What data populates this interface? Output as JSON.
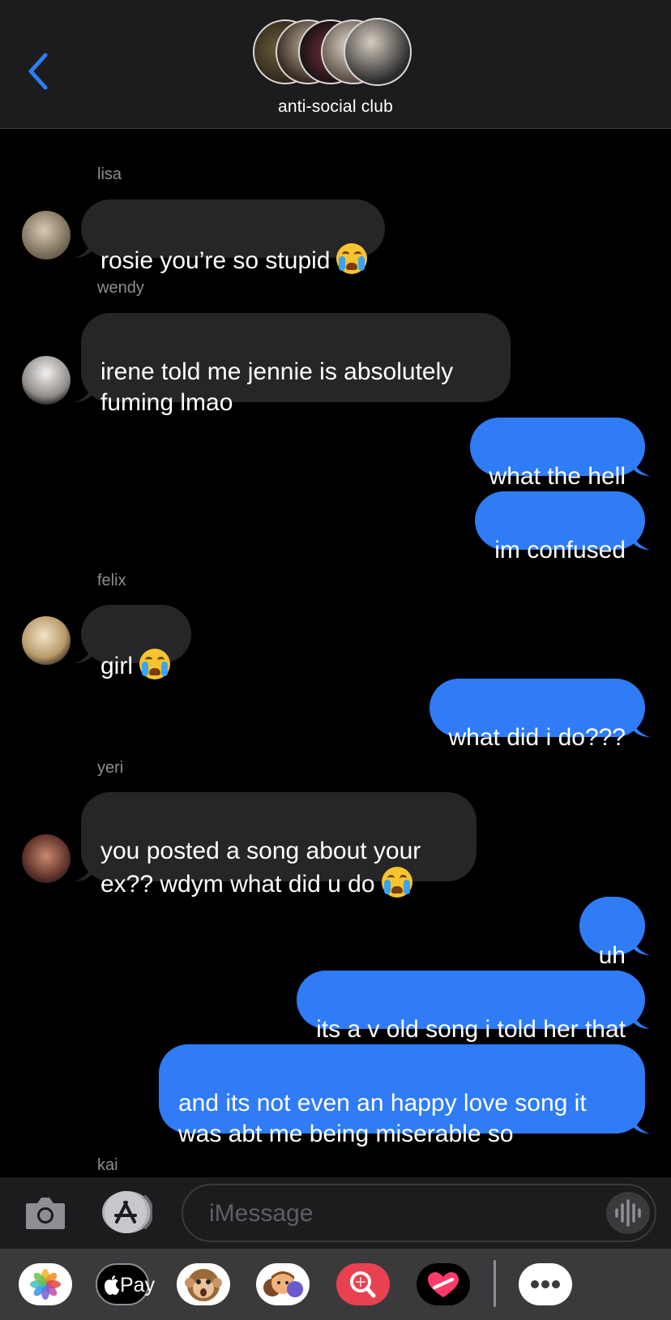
{
  "header": {
    "back_icon": "chevron-left-icon",
    "group_title": "anti-social club",
    "accent": "#2f7cf6"
  },
  "messages": [
    {
      "sender": "lisa",
      "text": "rosie you’re so stupid",
      "emoji": "loudly-crying-face"
    },
    {
      "sender": "wendy",
      "text": "irene told me jennie is absolutely\nfuming lmao"
    },
    {
      "sent": true,
      "text": "what the hell"
    },
    {
      "sent": true,
      "text": "im confused"
    },
    {
      "sender": "felix",
      "text": "girl",
      "emoji": "loudly-crying-face"
    },
    {
      "sent": true,
      "text": "what did i do???"
    },
    {
      "sender": "yeri",
      "text": "you posted a song about your\nex?? wdym what did u do",
      "emoji": "loudly-crying-face"
    },
    {
      "sent": true,
      "text": "uh"
    },
    {
      "sent": true,
      "text": "its a v old song i told her that"
    },
    {
      "sent": true,
      "text": "and its not even an happy love song it\nwas abt me being miserable so"
    },
    {
      "sender": "kai"
    }
  ],
  "input": {
    "placeholder": "iMessage",
    "camera_icon": "camera-icon",
    "appstore_icon": "app-store-icon",
    "audio_icon": "audio-waveform-icon"
  },
  "drawer": {
    "apps": [
      "photos-icon",
      "apple-pay-icon",
      "animoji-icon",
      "memoji-stickers-icon",
      "images-search-icon",
      "digital-touch-icon",
      "more-apps-icon"
    ],
    "apple_pay_label": "Pay"
  }
}
